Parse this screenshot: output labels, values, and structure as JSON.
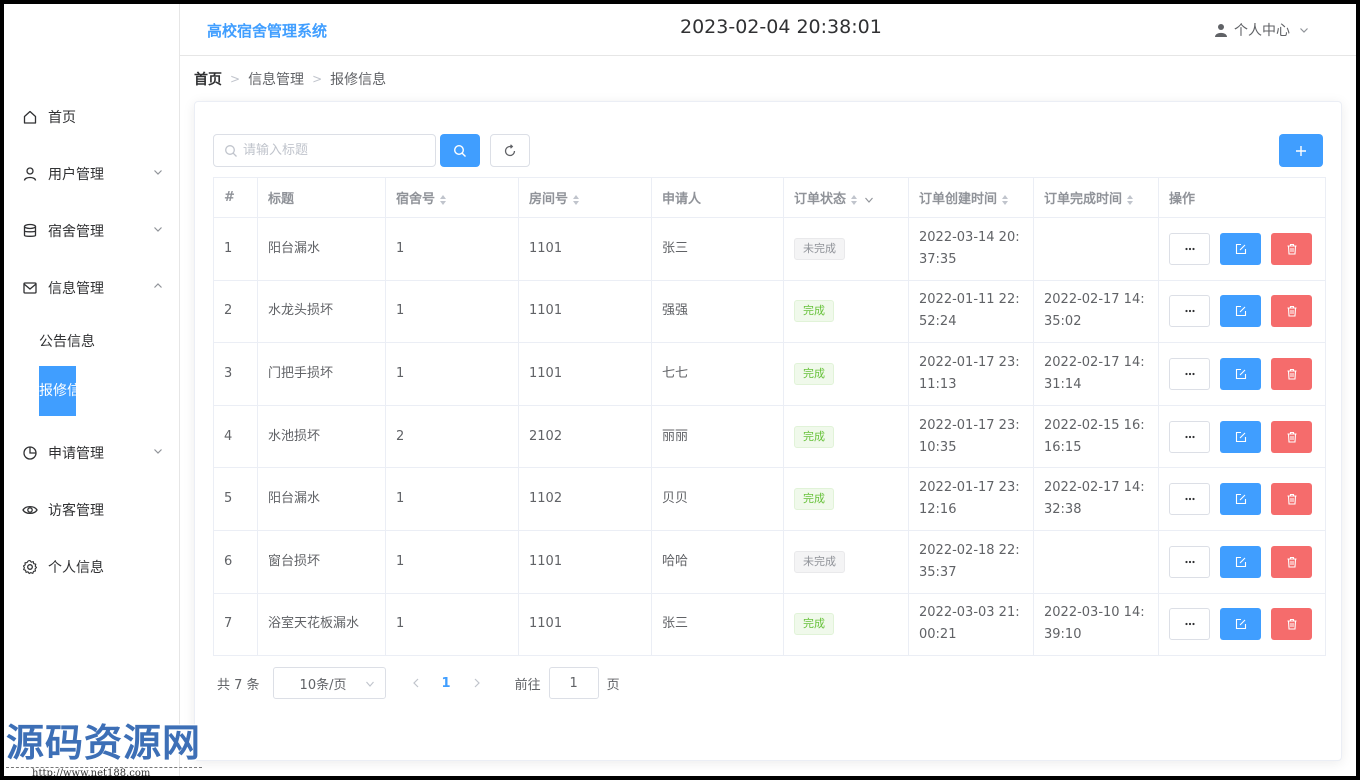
{
  "app": {
    "brand": "高校宿舍管理系统",
    "clock": "2023-02-04 20:38:01",
    "user_label": "个人中心"
  },
  "sidebar": {
    "items": [
      {
        "label": "首页",
        "icon": "home-icon"
      },
      {
        "label": "用户管理",
        "icon": "user-icon",
        "has_children": true
      },
      {
        "label": "宿舍管理",
        "icon": "database-icon",
        "has_children": true
      },
      {
        "label": "信息管理",
        "icon": "message-icon",
        "has_children": true,
        "expanded": true
      }
    ],
    "submenu": [
      {
        "label": "公告信息"
      },
      {
        "label": "报修信息",
        "active": true
      }
    ],
    "items_after": [
      {
        "label": "申请管理",
        "icon": "pie-chart-icon",
        "has_children": true
      },
      {
        "label": "访客管理",
        "icon": "eye-icon"
      },
      {
        "label": "个人信息",
        "icon": "settings-icon"
      }
    ],
    "accent": "#409eff"
  },
  "breadcrumb": [
    "首页",
    "信息管理",
    "报修信息"
  ],
  "search": {
    "placeholder": "请输入标题"
  },
  "table": {
    "headers": [
      "#",
      "标题",
      "宿舍号",
      "房间号",
      "申请人",
      "订单状态",
      "订单创建时间",
      "订单完成时间",
      "操作"
    ],
    "rows": [
      {
        "id": "1",
        "title": "阳台漏水",
        "dorm": "1",
        "room": "1101",
        "applicant": "张三",
        "status": "未完成",
        "created": "2022-03-14 20:37:35",
        "finished": ""
      },
      {
        "id": "2",
        "title": "水龙头损坏",
        "dorm": "1",
        "room": "1101",
        "applicant": "强强",
        "status": "完成",
        "created": "2022-01-11 22:52:24",
        "finished": "2022-02-17 14:35:02"
      },
      {
        "id": "3",
        "title": "门把手损坏",
        "dorm": "1",
        "room": "1101",
        "applicant": "七七",
        "status": "完成",
        "created": "2022-01-17 23:11:13",
        "finished": "2022-02-17 14:31:14"
      },
      {
        "id": "4",
        "title": "水池损坏",
        "dorm": "2",
        "room": "2102",
        "applicant": "丽丽",
        "status": "完成",
        "created": "2022-01-17 23:10:35",
        "finished": "2022-02-15 16:16:15"
      },
      {
        "id": "5",
        "title": "阳台漏水",
        "dorm": "1",
        "room": "1102",
        "applicant": "贝贝",
        "status": "完成",
        "created": "2022-01-17 23:12:16",
        "finished": "2022-02-17 14:32:38"
      },
      {
        "id": "6",
        "title": "窗台损坏",
        "dorm": "1",
        "room": "1101",
        "applicant": "哈哈",
        "status": "未完成",
        "created": "2022-02-18 22:35:37",
        "finished": ""
      },
      {
        "id": "7",
        "title": "浴室天花板漏水",
        "dorm": "1",
        "room": "1101",
        "applicant": "张三",
        "status": "完成",
        "created": "2022-03-03 21:00:21",
        "finished": "2022-03-10 14:39:10"
      }
    ]
  },
  "pager": {
    "total": "共 7 条",
    "page_size": "10条/页",
    "current": "1",
    "goto_label": "前往",
    "goto_value": "1",
    "page_suffix": "页"
  },
  "watermark": {
    "text": "源码资源网",
    "url": "http://www.net188.com"
  }
}
